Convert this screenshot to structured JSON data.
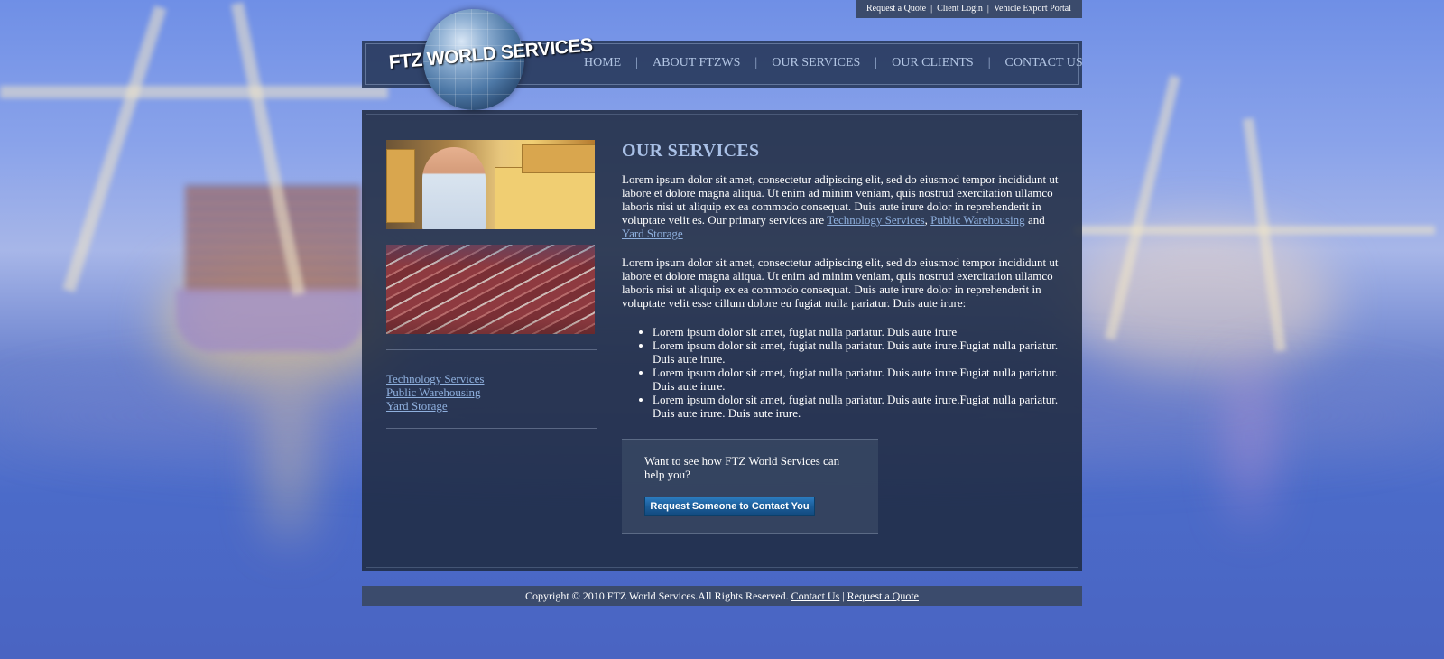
{
  "top_links": [
    "Request a Quote",
    "Client Login",
    "Vehicle Export Portal"
  ],
  "top_separator": "|",
  "logo": {
    "text": "FTZ WORLD SERVICES"
  },
  "nav": {
    "items": [
      "HOME",
      "ABOUT FTZWS",
      "OUR SERVICES",
      "OUR CLIENTS",
      "CONTACT US"
    ],
    "separator": "|"
  },
  "sidebar": {
    "links": [
      "Technology Services",
      "Public Warehousing",
      "Yard Storage"
    ]
  },
  "content": {
    "heading": "OUR SERVICES",
    "para1": "Lorem ipsum dolor sit amet, consectetur adipiscing elit, sed do eiusmod tempor incididunt ut labore et dolore magna aliqua. Ut enim ad minim veniam, quis nostrud exercitation ullamco laboris nisi ut aliquip ex ea commodo consequat. Duis aute irure dolor in reprehenderit in voluptate velit es. Our primary services are",
    "para1_link1": "Technology Services",
    "para1_comma": ",",
    "para1_link2": "Public Warehousing",
    "para1_and": "and",
    "para1_link3": "Yard Storage",
    "para2": "Lorem ipsum dolor sit amet, consectetur adipiscing elit, sed do eiusmod tempor incididunt ut labore et dolore magna aliqua. Ut enim ad minim veniam, quis nostrud exercitation ullamco laboris nisi ut aliquip ex ea commodo consequat. Duis aute irure dolor in reprehenderit in voluptate velit esse cillum dolore eu fugiat nulla pariatur. Duis aute irure:",
    "bullets": [
      "Lorem ipsum dolor sit amet, fugiat nulla pariatur. Duis aute irure",
      "Lorem ipsum dolor sit amet, fugiat nulla pariatur. Duis aute irure.Fugiat nulla pariatur. Duis aute irure.",
      "Lorem ipsum dolor sit amet, fugiat nulla pariatur. Duis aute irure.Fugiat nulla pariatur. Duis aute irure.",
      "Lorem ipsum dolor sit amet, fugiat nulla pariatur. Duis aute irure.Fugiat nulla pariatur. Duis aute irure. Duis aute irure."
    ]
  },
  "cta": {
    "question": "Want to see how FTZ World Services can help you?",
    "button": "Request Someone to Contact You"
  },
  "footer": {
    "copyright": "Copyright © 2010 FTZ World Services.All Rights Reserved.",
    "link1": "Contact Us",
    "separator": "|",
    "link2": "Request a Quote"
  },
  "colors": {
    "panel": "#1e2a40",
    "link": "#8fb0de",
    "heading": "#a9c0e6",
    "button": "#1b5c98"
  }
}
